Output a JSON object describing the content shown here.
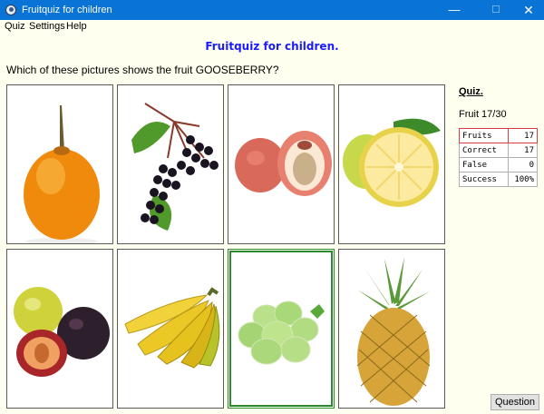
{
  "window": {
    "title": "Fruitquiz for children",
    "minimize": "—",
    "maximize": "☐",
    "close": "✕"
  },
  "menu": {
    "items": [
      "Quiz",
      "Settings",
      "Help"
    ]
  },
  "heading": "Fruitquiz for children.",
  "question": "Which of these pictures shows the fruit GOOSEBERRY?",
  "pictures": [
    {
      "fruit": "passion fruit",
      "selected": false
    },
    {
      "fruit": "elderberry",
      "selected": false
    },
    {
      "fruit": "lychee",
      "selected": false
    },
    {
      "fruit": "grapefruit",
      "selected": false
    },
    {
      "fruit": "plums",
      "selected": false
    },
    {
      "fruit": "bananas",
      "selected": false
    },
    {
      "fruit": "gooseberry",
      "selected": true
    },
    {
      "fruit": "pineapple",
      "selected": false
    }
  ],
  "sidebar": {
    "heading": "Quiz.",
    "progress": "Fruit 17/30",
    "stats": [
      {
        "label": "Fruits",
        "value": "17"
      },
      {
        "label": "Correct",
        "value": "17"
      },
      {
        "label": "False",
        "value": "0"
      },
      {
        "label": "Success",
        "value": "100%"
      }
    ]
  },
  "question_button": "Question",
  "colors": {
    "titlebar": "#0a73d6",
    "heading": "#1a1aff",
    "background": "#fffff0",
    "selection": "#2b8a2b"
  }
}
